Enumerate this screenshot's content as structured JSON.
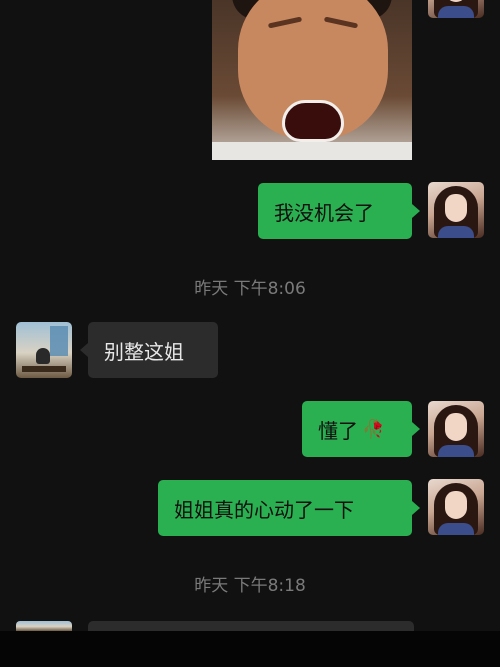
{
  "messages": [
    {
      "id": "m1",
      "direction": "out",
      "text": "我没机会了"
    },
    {
      "id": "m2",
      "direction": "in",
      "text": "别整这姐"
    },
    {
      "id": "m3",
      "direction": "out",
      "text": "懂了",
      "emoji": "🥀"
    },
    {
      "id": "m4",
      "direction": "out",
      "text": "姐姐真的心动了一下"
    }
  ],
  "timestamps": [
    {
      "text": "昨天 下午8:06"
    },
    {
      "text": "昨天 下午8:18"
    }
  ],
  "colors": {
    "background": "#111111",
    "outgoing_bubble": "#2ab051",
    "incoming_bubble": "#2c2c2c",
    "timestamp_text": "#7a7a7a"
  },
  "icons": {
    "flower_emoji": "wilted-rose-icon"
  }
}
